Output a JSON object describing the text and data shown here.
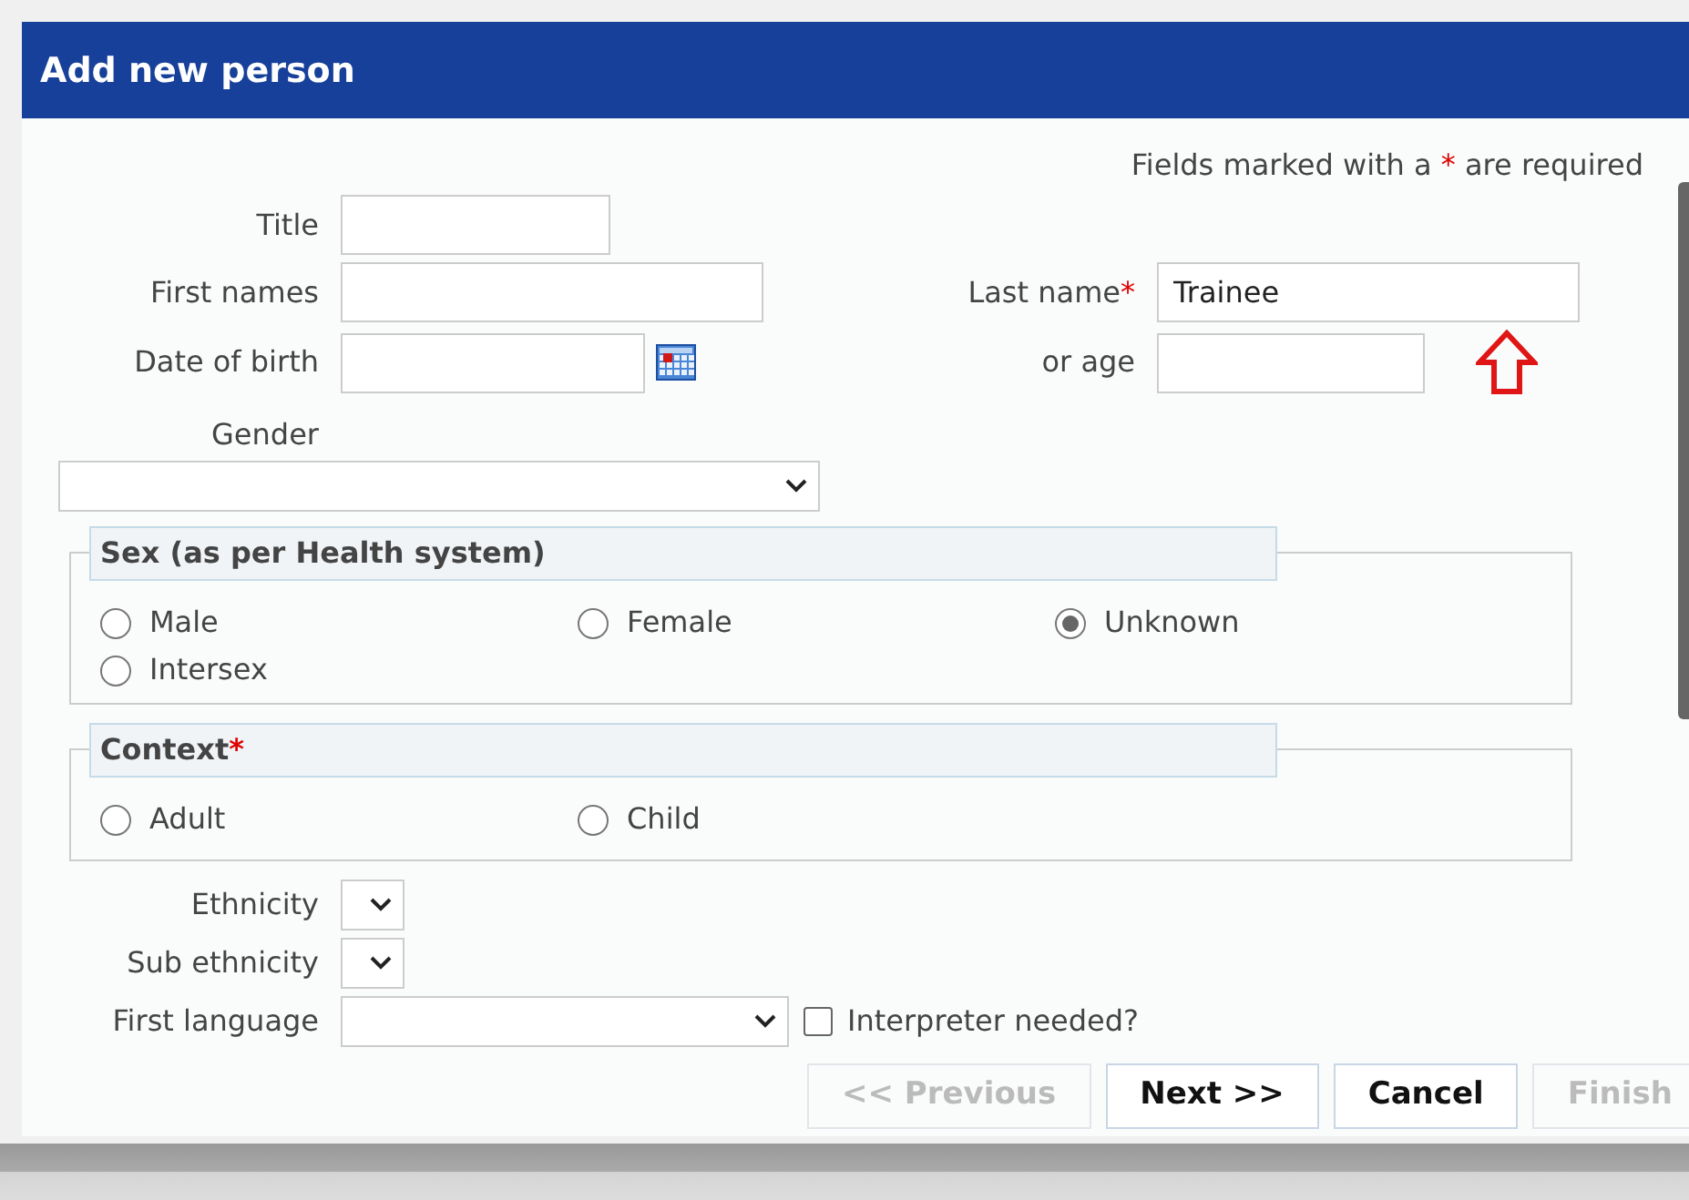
{
  "dialog": {
    "title": "Add new person"
  },
  "required_note": {
    "before": "Fields marked with a",
    "marker": "*",
    "after": "are required"
  },
  "title_field": {
    "label": "Title"
  },
  "first_names": {
    "label": "First names"
  },
  "last_name": {
    "label": "Last name",
    "required_marker": "*",
    "value": "Trainee"
  },
  "date_of_birth": {
    "label": "Date of birth"
  },
  "age": {
    "label": "or age"
  },
  "gender": {
    "label": "Gender"
  },
  "sex_group": {
    "legend": "Sex (as per Health system)",
    "options": [
      {
        "label": "Male",
        "selected": false
      },
      {
        "label": "Female",
        "selected": false
      },
      {
        "label": "Unknown",
        "selected": true
      },
      {
        "label": "Intersex",
        "selected": false
      }
    ]
  },
  "context_group": {
    "legend": "Context",
    "required_marker": "*",
    "options": [
      {
        "label": "Adult",
        "selected": false
      },
      {
        "label": "Child",
        "selected": false
      }
    ]
  },
  "ethnicity": {
    "label": "Ethnicity"
  },
  "sub_ethnicity": {
    "label": "Sub ethnicity"
  },
  "first_language": {
    "label": "First language"
  },
  "interpreter": {
    "label": "Interpreter needed?",
    "checked": false
  },
  "buttons": [
    {
      "label": "<< Previous",
      "disabled": true
    },
    {
      "label": "Next >>",
      "disabled": false
    },
    {
      "label": "Cancel",
      "disabled": false
    },
    {
      "label": "Finish",
      "disabled": true
    }
  ]
}
